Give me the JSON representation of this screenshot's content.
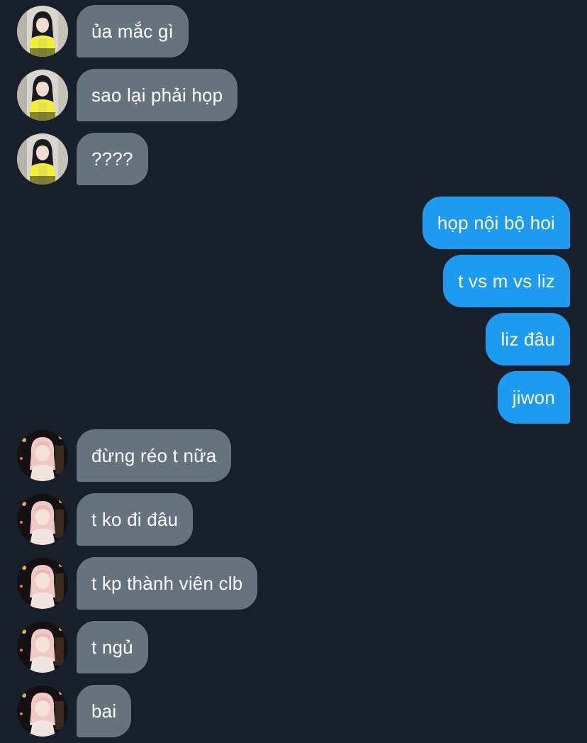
{
  "conversation": {
    "colors": {
      "background": "#17202a",
      "incoming_bubble": "#66737f",
      "outgoing_bubble": "#1d9bf0",
      "text": "#ffffff"
    },
    "messages": [
      {
        "direction": "incoming",
        "sender_avatar": "contact-1-avatar",
        "text": "ủa mắc gì"
      },
      {
        "direction": "incoming",
        "sender_avatar": "contact-1-avatar",
        "text": "sao lại phải họp"
      },
      {
        "direction": "incoming",
        "sender_avatar": "contact-1-avatar",
        "text": "????"
      },
      {
        "direction": "outgoing",
        "text": "họp nội bộ hoi"
      },
      {
        "direction": "outgoing",
        "text": "t vs m vs liz"
      },
      {
        "direction": "outgoing",
        "text": "liz đâu"
      },
      {
        "direction": "outgoing",
        "text": "jiwon"
      },
      {
        "direction": "incoming",
        "sender_avatar": "contact-2-avatar",
        "text": "đừng réo t nữa"
      },
      {
        "direction": "incoming",
        "sender_avatar": "contact-2-avatar",
        "text": "t ko đi đâu"
      },
      {
        "direction": "incoming",
        "sender_avatar": "contact-2-avatar",
        "text": "t kp thành viên clb"
      },
      {
        "direction": "incoming",
        "sender_avatar": "contact-2-avatar",
        "text": "t ngủ"
      },
      {
        "direction": "incoming",
        "sender_avatar": "contact-2-avatar",
        "text": "bai"
      }
    ]
  }
}
